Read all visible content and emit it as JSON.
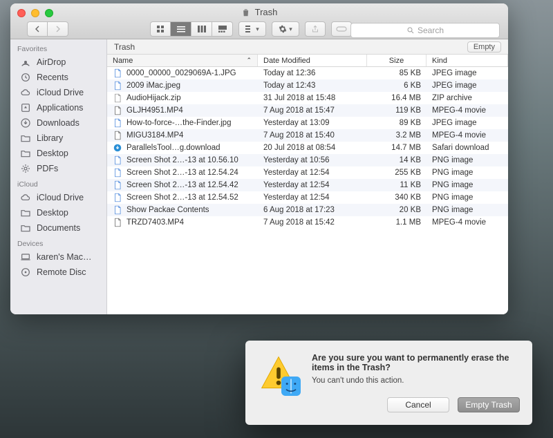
{
  "window": {
    "title": "Trash"
  },
  "search": {
    "placeholder": "Search"
  },
  "sidebar": {
    "sections": [
      {
        "label": "Favorites",
        "items": [
          {
            "icon": "airdrop",
            "label": "AirDrop"
          },
          {
            "icon": "recents",
            "label": "Recents"
          },
          {
            "icon": "cloud",
            "label": "iCloud Drive"
          },
          {
            "icon": "apps",
            "label": "Applications"
          },
          {
            "icon": "downloads",
            "label": "Downloads"
          },
          {
            "icon": "folder",
            "label": "Library"
          },
          {
            "icon": "folder",
            "label": "Desktop"
          },
          {
            "icon": "gear",
            "label": "PDFs"
          }
        ]
      },
      {
        "label": "iCloud",
        "items": [
          {
            "icon": "cloud",
            "label": "iCloud Drive"
          },
          {
            "icon": "folder",
            "label": "Desktop"
          },
          {
            "icon": "folder",
            "label": "Documents"
          }
        ]
      },
      {
        "label": "Devices",
        "items": [
          {
            "icon": "mac",
            "label": "karen's Mac…"
          },
          {
            "icon": "disc",
            "label": "Remote Disc"
          }
        ]
      }
    ]
  },
  "pathbar": {
    "location": "Trash",
    "empty": "Empty"
  },
  "columns": {
    "name": "Name",
    "date": "Date Modified",
    "size": "Size",
    "kind": "Kind"
  },
  "files": [
    {
      "icon": "jpg",
      "name": "0000_00000_0029069A-1.JPG",
      "date": "Today at 12:36",
      "size": "85 KB",
      "kind": "JPEG image"
    },
    {
      "icon": "jpg",
      "name": "2009 iMac.jpeg",
      "date": "Today at 12:43",
      "size": "6 KB",
      "kind": "JPEG image"
    },
    {
      "icon": "zip",
      "name": "AudioHijack.zip",
      "date": "31 Jul 2018 at 15:48",
      "size": "16.4 MB",
      "kind": "ZIP archive"
    },
    {
      "icon": "mov",
      "name": "GLJH4951.MP4",
      "date": "7 Aug 2018 at 15:47",
      "size": "119 KB",
      "kind": "MPEG-4 movie"
    },
    {
      "icon": "jpg",
      "name": "How-to-force-…the-Finder.jpg",
      "date": "Yesterday at 13:09",
      "size": "89 KB",
      "kind": "JPEG image"
    },
    {
      "icon": "mov",
      "name": "MIGU3184.MP4",
      "date": "7 Aug 2018 at 15:40",
      "size": "3.2 MB",
      "kind": "MPEG-4 movie"
    },
    {
      "icon": "dl",
      "name": "ParallelsTool…g.download",
      "date": "20 Jul 2018 at 08:54",
      "size": "14.7 MB",
      "kind": "Safari download"
    },
    {
      "icon": "png",
      "name": "Screen Shot 2…-13 at 10.56.10",
      "date": "Yesterday at 10:56",
      "size": "14 KB",
      "kind": "PNG image"
    },
    {
      "icon": "png",
      "name": "Screen Shot 2…-13 at 12.54.24",
      "date": "Yesterday at 12:54",
      "size": "255 KB",
      "kind": "PNG image"
    },
    {
      "icon": "png",
      "name": "Screen Shot 2…-13 at 12.54.42",
      "date": "Yesterday at 12:54",
      "size": "11 KB",
      "kind": "PNG image"
    },
    {
      "icon": "png",
      "name": "Screen Shot 2…-13 at 12.54.52",
      "date": "Yesterday at 12:54",
      "size": "340 KB",
      "kind": "PNG image"
    },
    {
      "icon": "png",
      "name": "Show Packae Contents",
      "date": "6 Aug 2018 at 17:23",
      "size": "20 KB",
      "kind": "PNG image"
    },
    {
      "icon": "mov",
      "name": "TRZD7403.MP4",
      "date": "7 Aug 2018 at 15:42",
      "size": "1.1 MB",
      "kind": "MPEG-4 movie"
    }
  ],
  "dialog": {
    "title": "Are you sure you want to permanently erase the items in the Trash?",
    "text": "You can't undo this action.",
    "cancel": "Cancel",
    "confirm": "Empty Trash"
  }
}
